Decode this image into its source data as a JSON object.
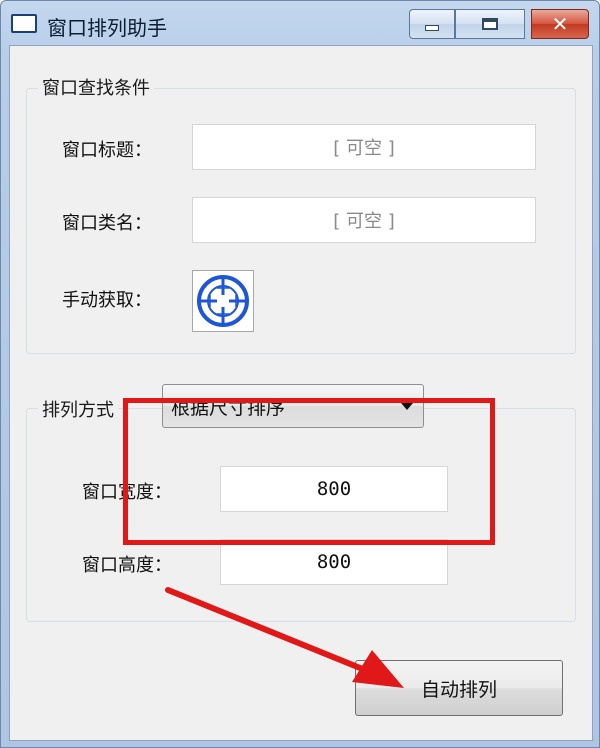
{
  "window": {
    "title": "窗口排列助手",
    "close_glyph": "✕"
  },
  "search_group": {
    "caption": "窗口查找条件",
    "title_label": "窗口标题：",
    "title_placeholder": "[ 可空 ]",
    "class_label": "窗口类名：",
    "class_placeholder": "[ 可空 ]",
    "manual_label": "手动获取：",
    "picker_icon": "crosshair-target-icon"
  },
  "arrange_group": {
    "caption": "排列方式",
    "mode_selected": "根据尺寸排序",
    "width_label": "窗口宽度：",
    "width_value": "800",
    "height_label": "窗口高度：",
    "height_value": "800"
  },
  "actions": {
    "auto_arrange_label": "自动排列"
  },
  "colors": {
    "annotation": "#e01818",
    "picker_blue": "#1f56d6"
  }
}
